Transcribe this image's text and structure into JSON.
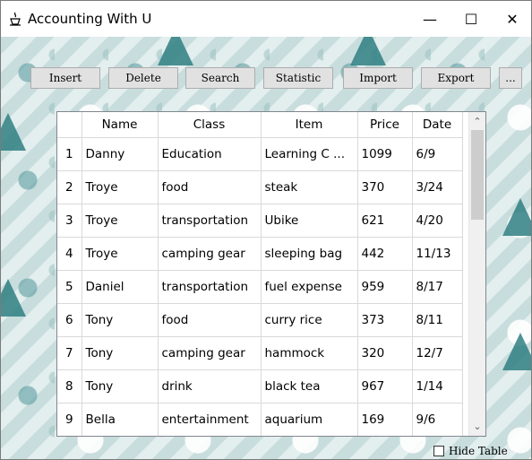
{
  "window": {
    "title": "Accounting With U",
    "minimize_glyph": "—",
    "maximize_glyph": "☐",
    "close_glyph": "✕",
    "icon": "app-icon"
  },
  "toolbar": {
    "insert_label": "Insert",
    "delete_label": "Delete",
    "search_label": "Search",
    "statistic_label": "Statistic",
    "import_label": "Import",
    "export_label": "Export",
    "more_label": "..."
  },
  "table": {
    "columns": [
      "Name",
      "Class",
      "Item",
      "Price",
      "Date"
    ],
    "rows": [
      {
        "index": "1",
        "name": "Danny",
        "class": "Education",
        "item": "Learning C ...",
        "price": "1099",
        "date": "6/9"
      },
      {
        "index": "2",
        "name": "Troye",
        "class": "food",
        "item": "steak",
        "price": "370",
        "date": "3/24"
      },
      {
        "index": "3",
        "name": "Troye",
        "class": "transportation",
        "item": "Ubike",
        "price": "621",
        "date": "4/20"
      },
      {
        "index": "4",
        "name": "Troye",
        "class": "camping gear",
        "item": "sleeping bag",
        "price": "442",
        "date": "11/13"
      },
      {
        "index": "5",
        "name": "Daniel",
        "class": "transportation",
        "item": "fuel expense",
        "price": "959",
        "date": "8/17"
      },
      {
        "index": "6",
        "name": "Tony",
        "class": "food",
        "item": "curry rice",
        "price": "373",
        "date": "8/11"
      },
      {
        "index": "7",
        "name": "Tony",
        "class": "camping gear",
        "item": "hammock",
        "price": "320",
        "date": "12/7"
      },
      {
        "index": "8",
        "name": "Tony",
        "class": "drink",
        "item": "black tea",
        "price": "967",
        "date": "1/14"
      },
      {
        "index": "9",
        "name": "Bella",
        "class": "entertainment",
        "item": "aquarium",
        "price": "169",
        "date": "9/6"
      }
    ]
  },
  "scrollbar": {
    "up_glyph": "⌃",
    "down_glyph": "⌄"
  },
  "footer": {
    "hide_table_label": "Hide Table",
    "hide_table_checked": false
  }
}
